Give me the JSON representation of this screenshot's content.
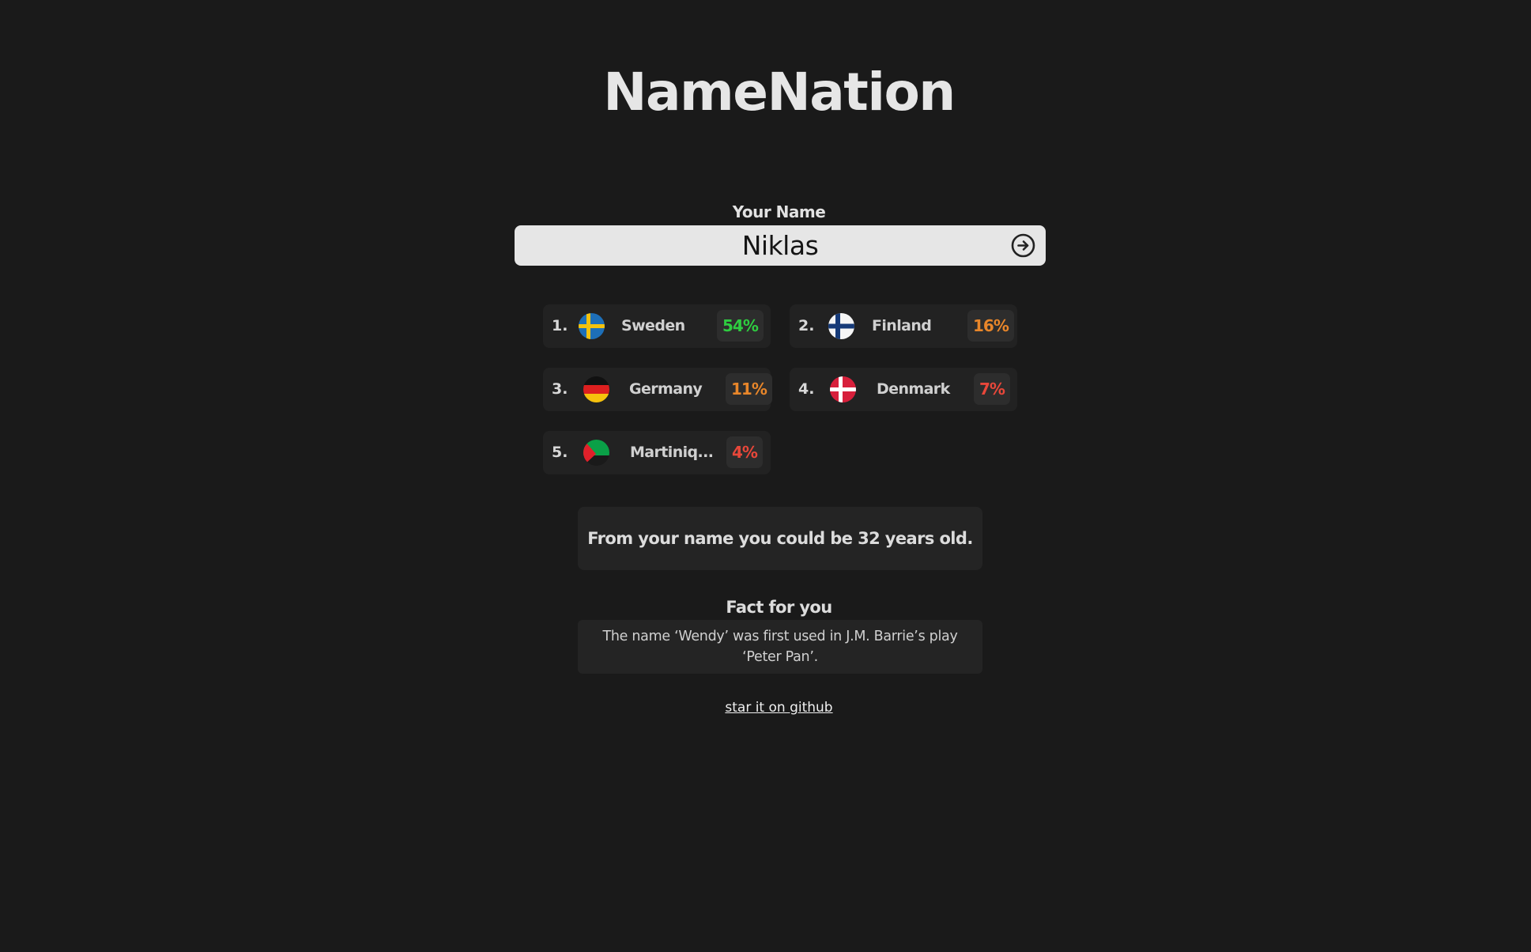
{
  "app": {
    "title": "NameNation"
  },
  "name_form": {
    "label": "Your Name",
    "value": "Niklas",
    "submit_icon": "arrow-right-circle-icon"
  },
  "results": [
    {
      "rank": "1.",
      "country": "Sweden",
      "percent": "54%",
      "percent_color": "#2ecc40",
      "flag_icon": "sweden-flag-icon"
    },
    {
      "rank": "2.",
      "country": "Finland",
      "percent": "16%",
      "percent_color": "#e8862a",
      "flag_icon": "finland-flag-icon"
    },
    {
      "rank": "3.",
      "country": "Germany",
      "percent": "11%",
      "percent_color": "#e8862a",
      "flag_icon": "germany-flag-icon"
    },
    {
      "rank": "4.",
      "country": "Denmark",
      "percent": "7%",
      "percent_color": "#e8473a",
      "flag_icon": "denmark-flag-icon"
    },
    {
      "rank": "5.",
      "country": "Martiniq...",
      "percent": "4%",
      "percent_color": "#e8473a",
      "flag_icon": "martinique-flag-icon"
    }
  ],
  "age": {
    "text": "From your name you could be 32 years old."
  },
  "fact": {
    "title": "Fact for you",
    "text": "The name ‘Wendy’ was first used in J.M. Barrie’s play ‘Peter Pan’."
  },
  "footer": {
    "github_link": "star it on github"
  },
  "colors": {
    "background": "#1a1a1a",
    "card": "#222222",
    "input": "#e6e6e6",
    "high": "#2ecc40",
    "medium": "#e8862a",
    "low": "#e8473a"
  }
}
